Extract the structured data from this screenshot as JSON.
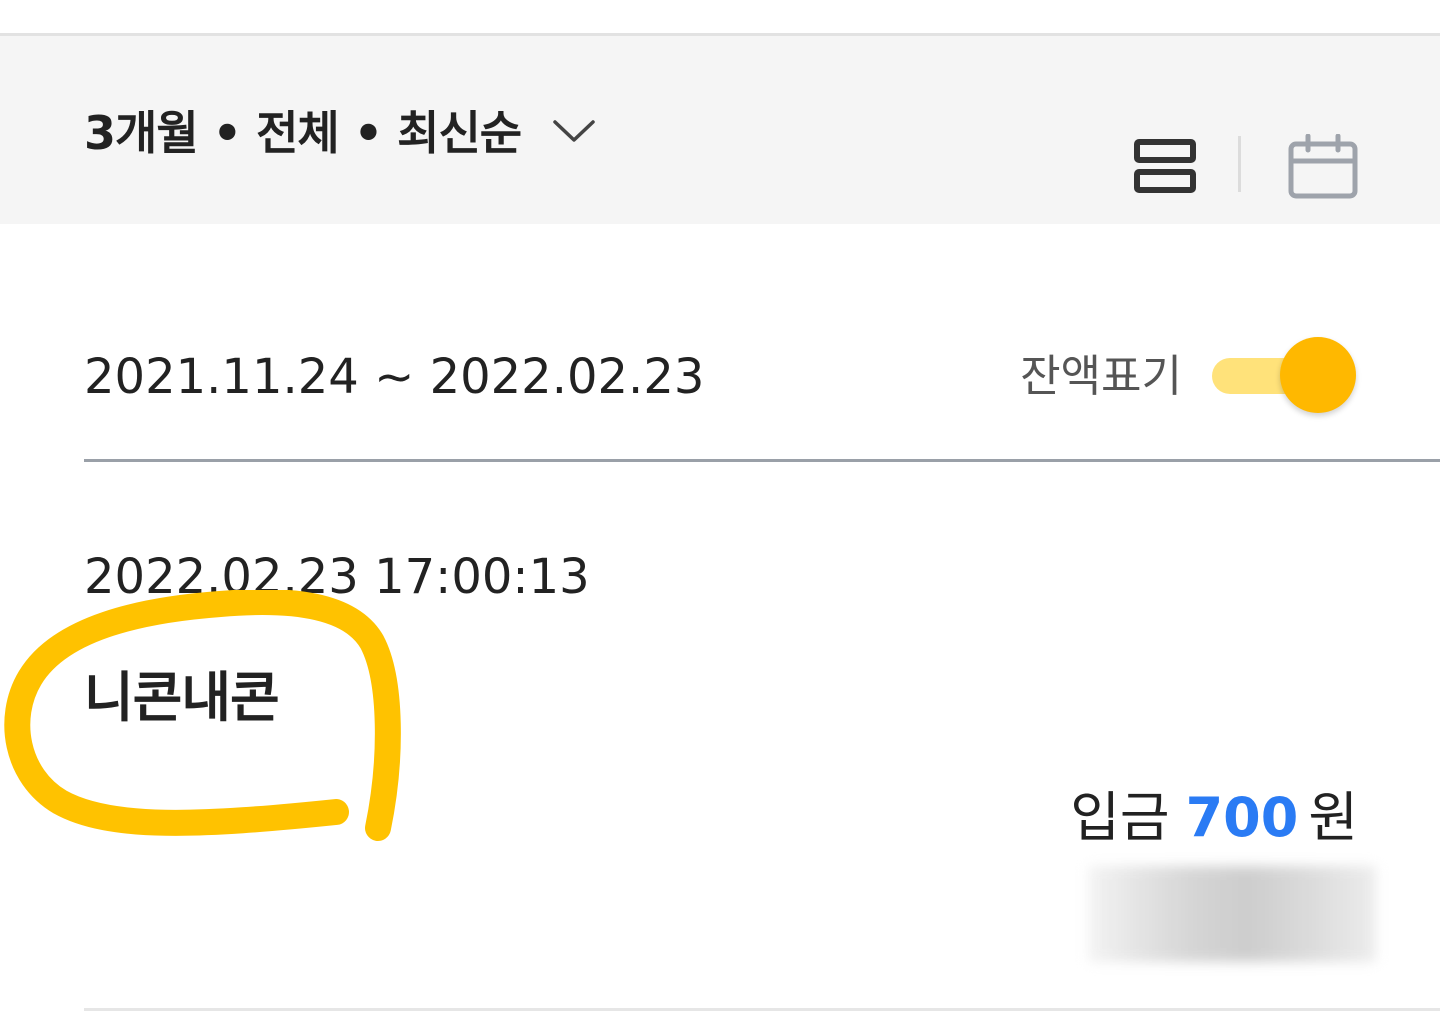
{
  "filter": {
    "summary": "3개월 • 전체 • 최신순"
  },
  "view_toggle": {
    "list_icon": "list-view-icon",
    "calendar_icon": "calendar-icon"
  },
  "period": {
    "range": "2021.11.24 ~ 2022.02.23"
  },
  "balance_display": {
    "label": "잔액표기",
    "enabled": true
  },
  "transactions": [
    {
      "datetime": "2022.02.23 17:00:13",
      "name": "니콘내콘",
      "type": "입금",
      "amount": "700",
      "unit": "원"
    }
  ],
  "colors": {
    "accent_yellow": "#ffb800",
    "toggle_track": "#ffe27a",
    "amount_blue": "#2a7bf4",
    "highlight": "#ffc200"
  }
}
